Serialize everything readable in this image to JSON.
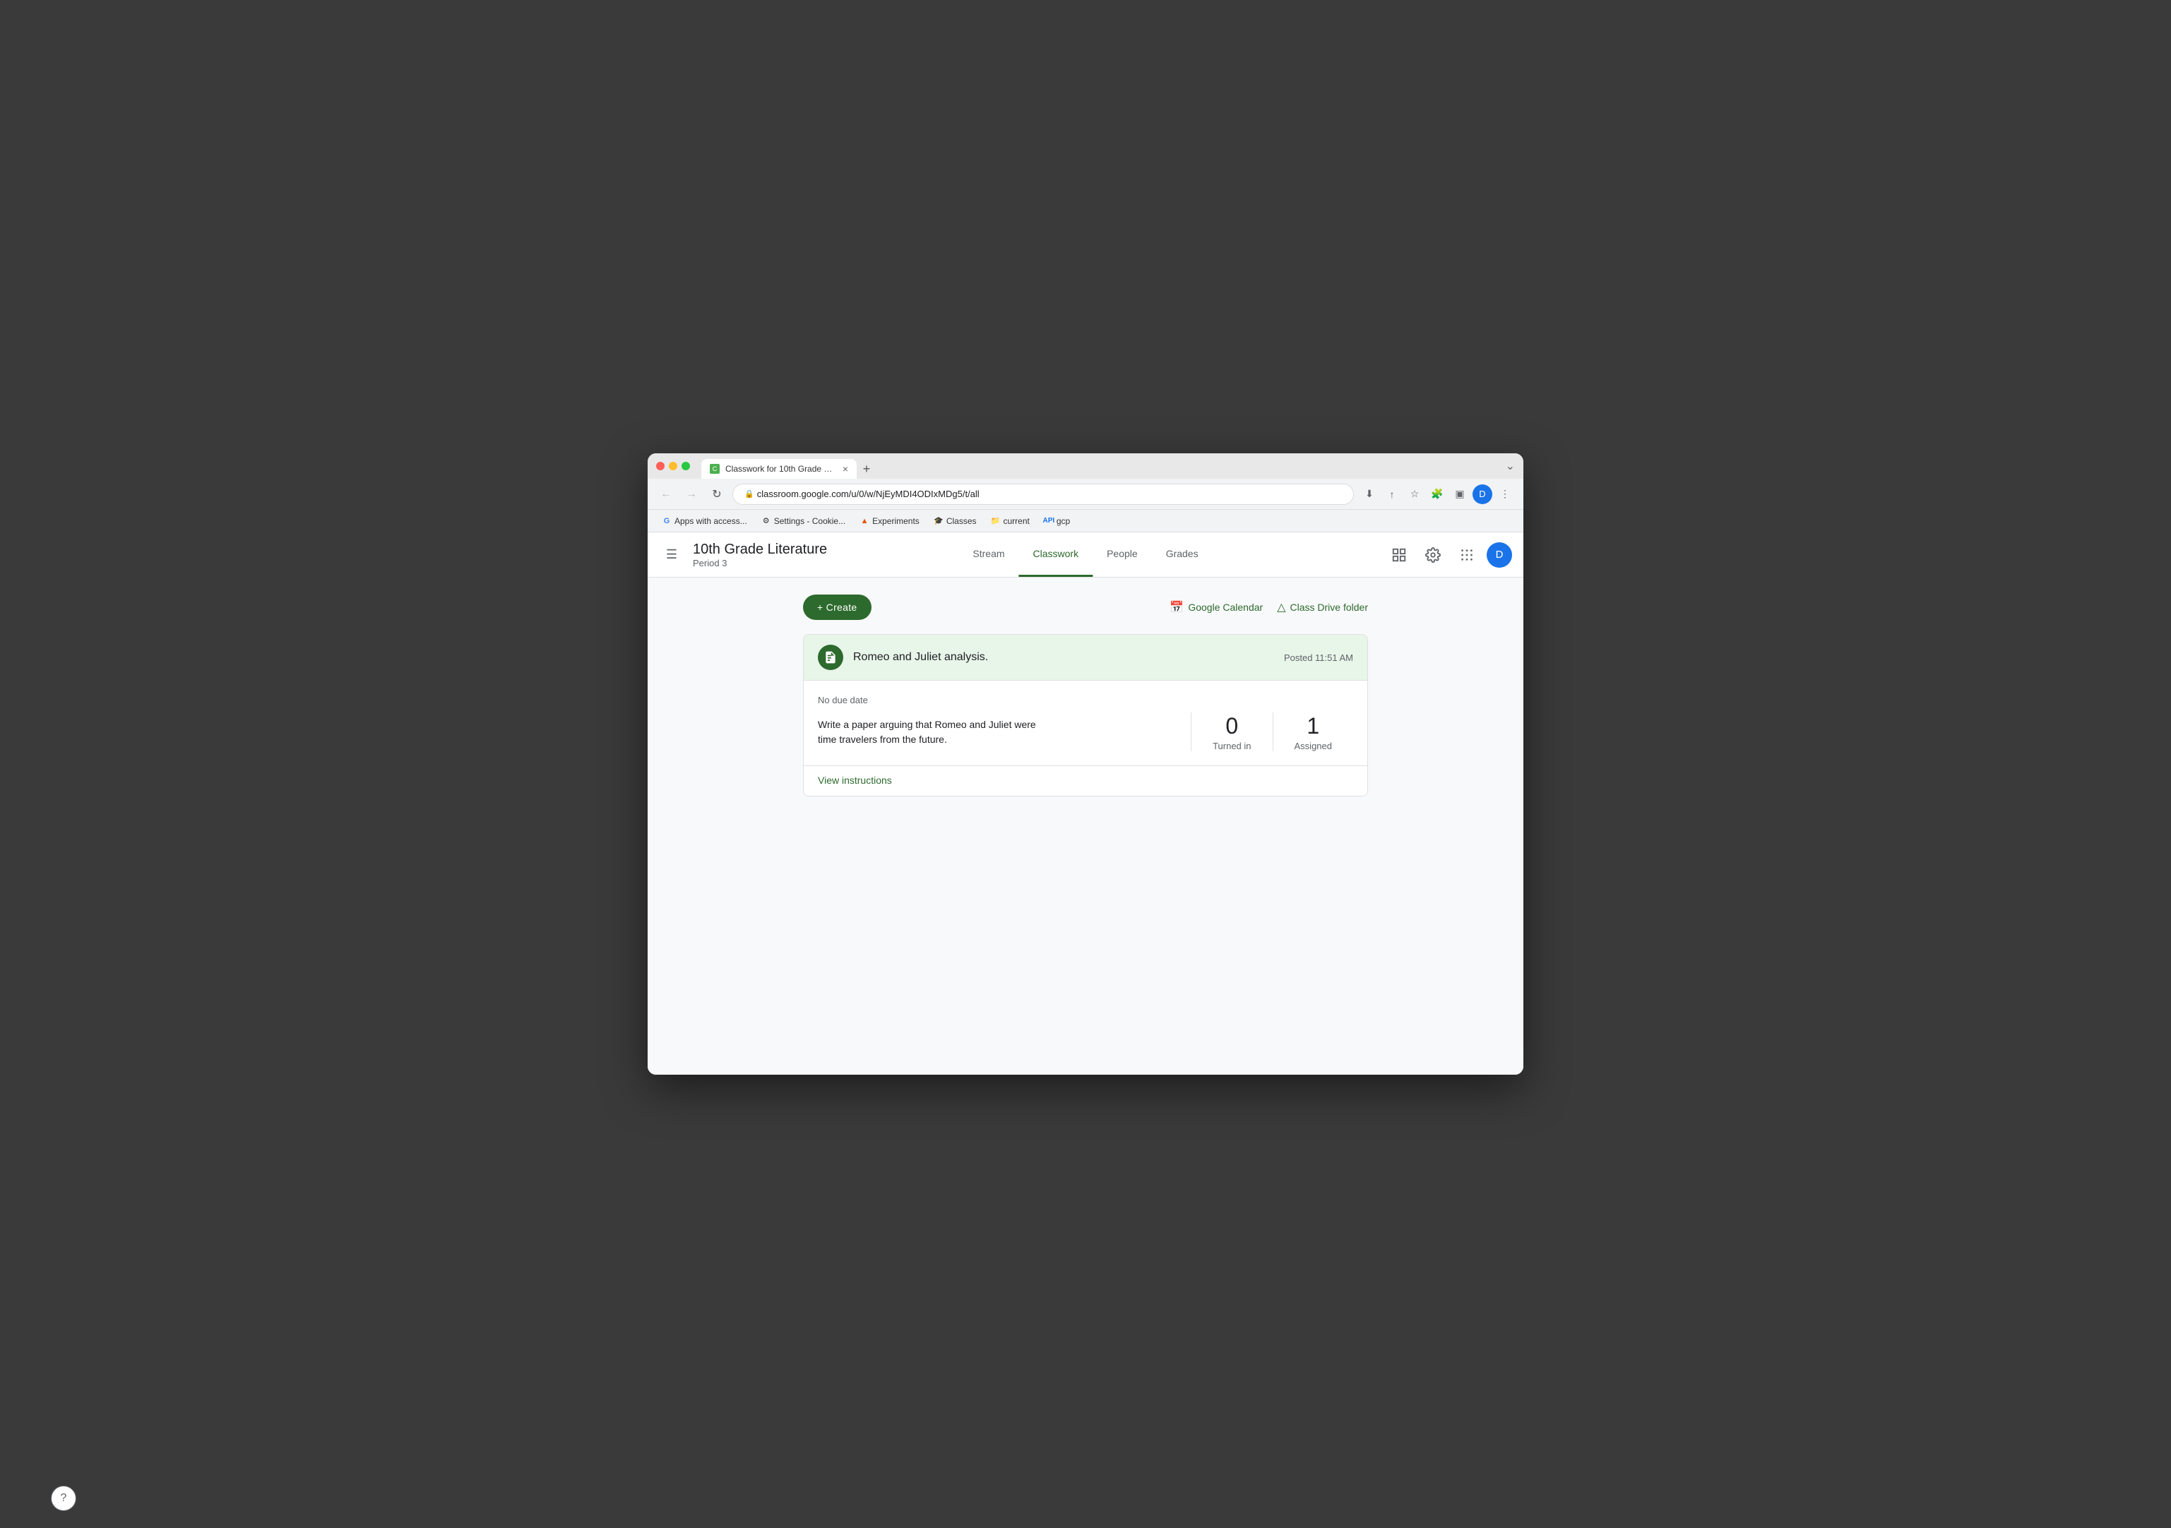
{
  "browser": {
    "tab": {
      "favicon_label": "C",
      "title": "Classwork for 10th Grade Liter...",
      "close_label": "×"
    },
    "new_tab_label": "+",
    "title_bar_chevron": "⌄",
    "address": "classroom.google.com/u/0/w/NjEyMDI4ODIxMDg5/t/all",
    "nav": {
      "back_label": "←",
      "forward_label": "→",
      "refresh_label": "↻"
    },
    "addr_icons": {
      "download": "⬇",
      "share": "↑",
      "star": "☆",
      "extension": "🧩",
      "sidebar": "▣",
      "more": "⋮"
    },
    "profile_initial": "D",
    "bookmarks": [
      {
        "icon": "G",
        "label": "Apps with access..."
      },
      {
        "icon": "⚙",
        "label": "Settings - Cookie..."
      },
      {
        "icon": "▲",
        "label": "Experiments"
      },
      {
        "icon": "🎓",
        "label": "Classes"
      },
      {
        "icon": "📁",
        "label": "current"
      },
      {
        "icon": "API",
        "label": "gcp"
      }
    ]
  },
  "app": {
    "header": {
      "menu_icon": "☰",
      "class_name": "10th Grade Literature",
      "class_period": "Period 3",
      "nav_tabs": [
        {
          "id": "stream",
          "label": "Stream",
          "active": false
        },
        {
          "id": "classwork",
          "label": "Classwork",
          "active": true
        },
        {
          "id": "people",
          "label": "People",
          "active": false
        },
        {
          "id": "grades",
          "label": "Grades",
          "active": false
        }
      ],
      "profile_initial": "D"
    },
    "content": {
      "create_button_label": "+ Create",
      "top_links": [
        {
          "id": "google-calendar",
          "icon": "📅",
          "label": "Google Calendar"
        },
        {
          "id": "class-drive-folder",
          "icon": "△",
          "label": "Class Drive folder"
        }
      ],
      "assignment_card": {
        "icon": "📋",
        "title": "Romeo and Juliet analysis.",
        "posted_time": "Posted 11:51 AM",
        "due_date": "No due date",
        "description": "Write a paper arguing that Romeo and Juliet were\ntime travelers from the future.",
        "stats": [
          {
            "number": "0",
            "label": "Turned in"
          },
          {
            "number": "1",
            "label": "Assigned"
          }
        ],
        "view_instructions_label": "View instructions"
      }
    }
  },
  "help_button_label": "?"
}
